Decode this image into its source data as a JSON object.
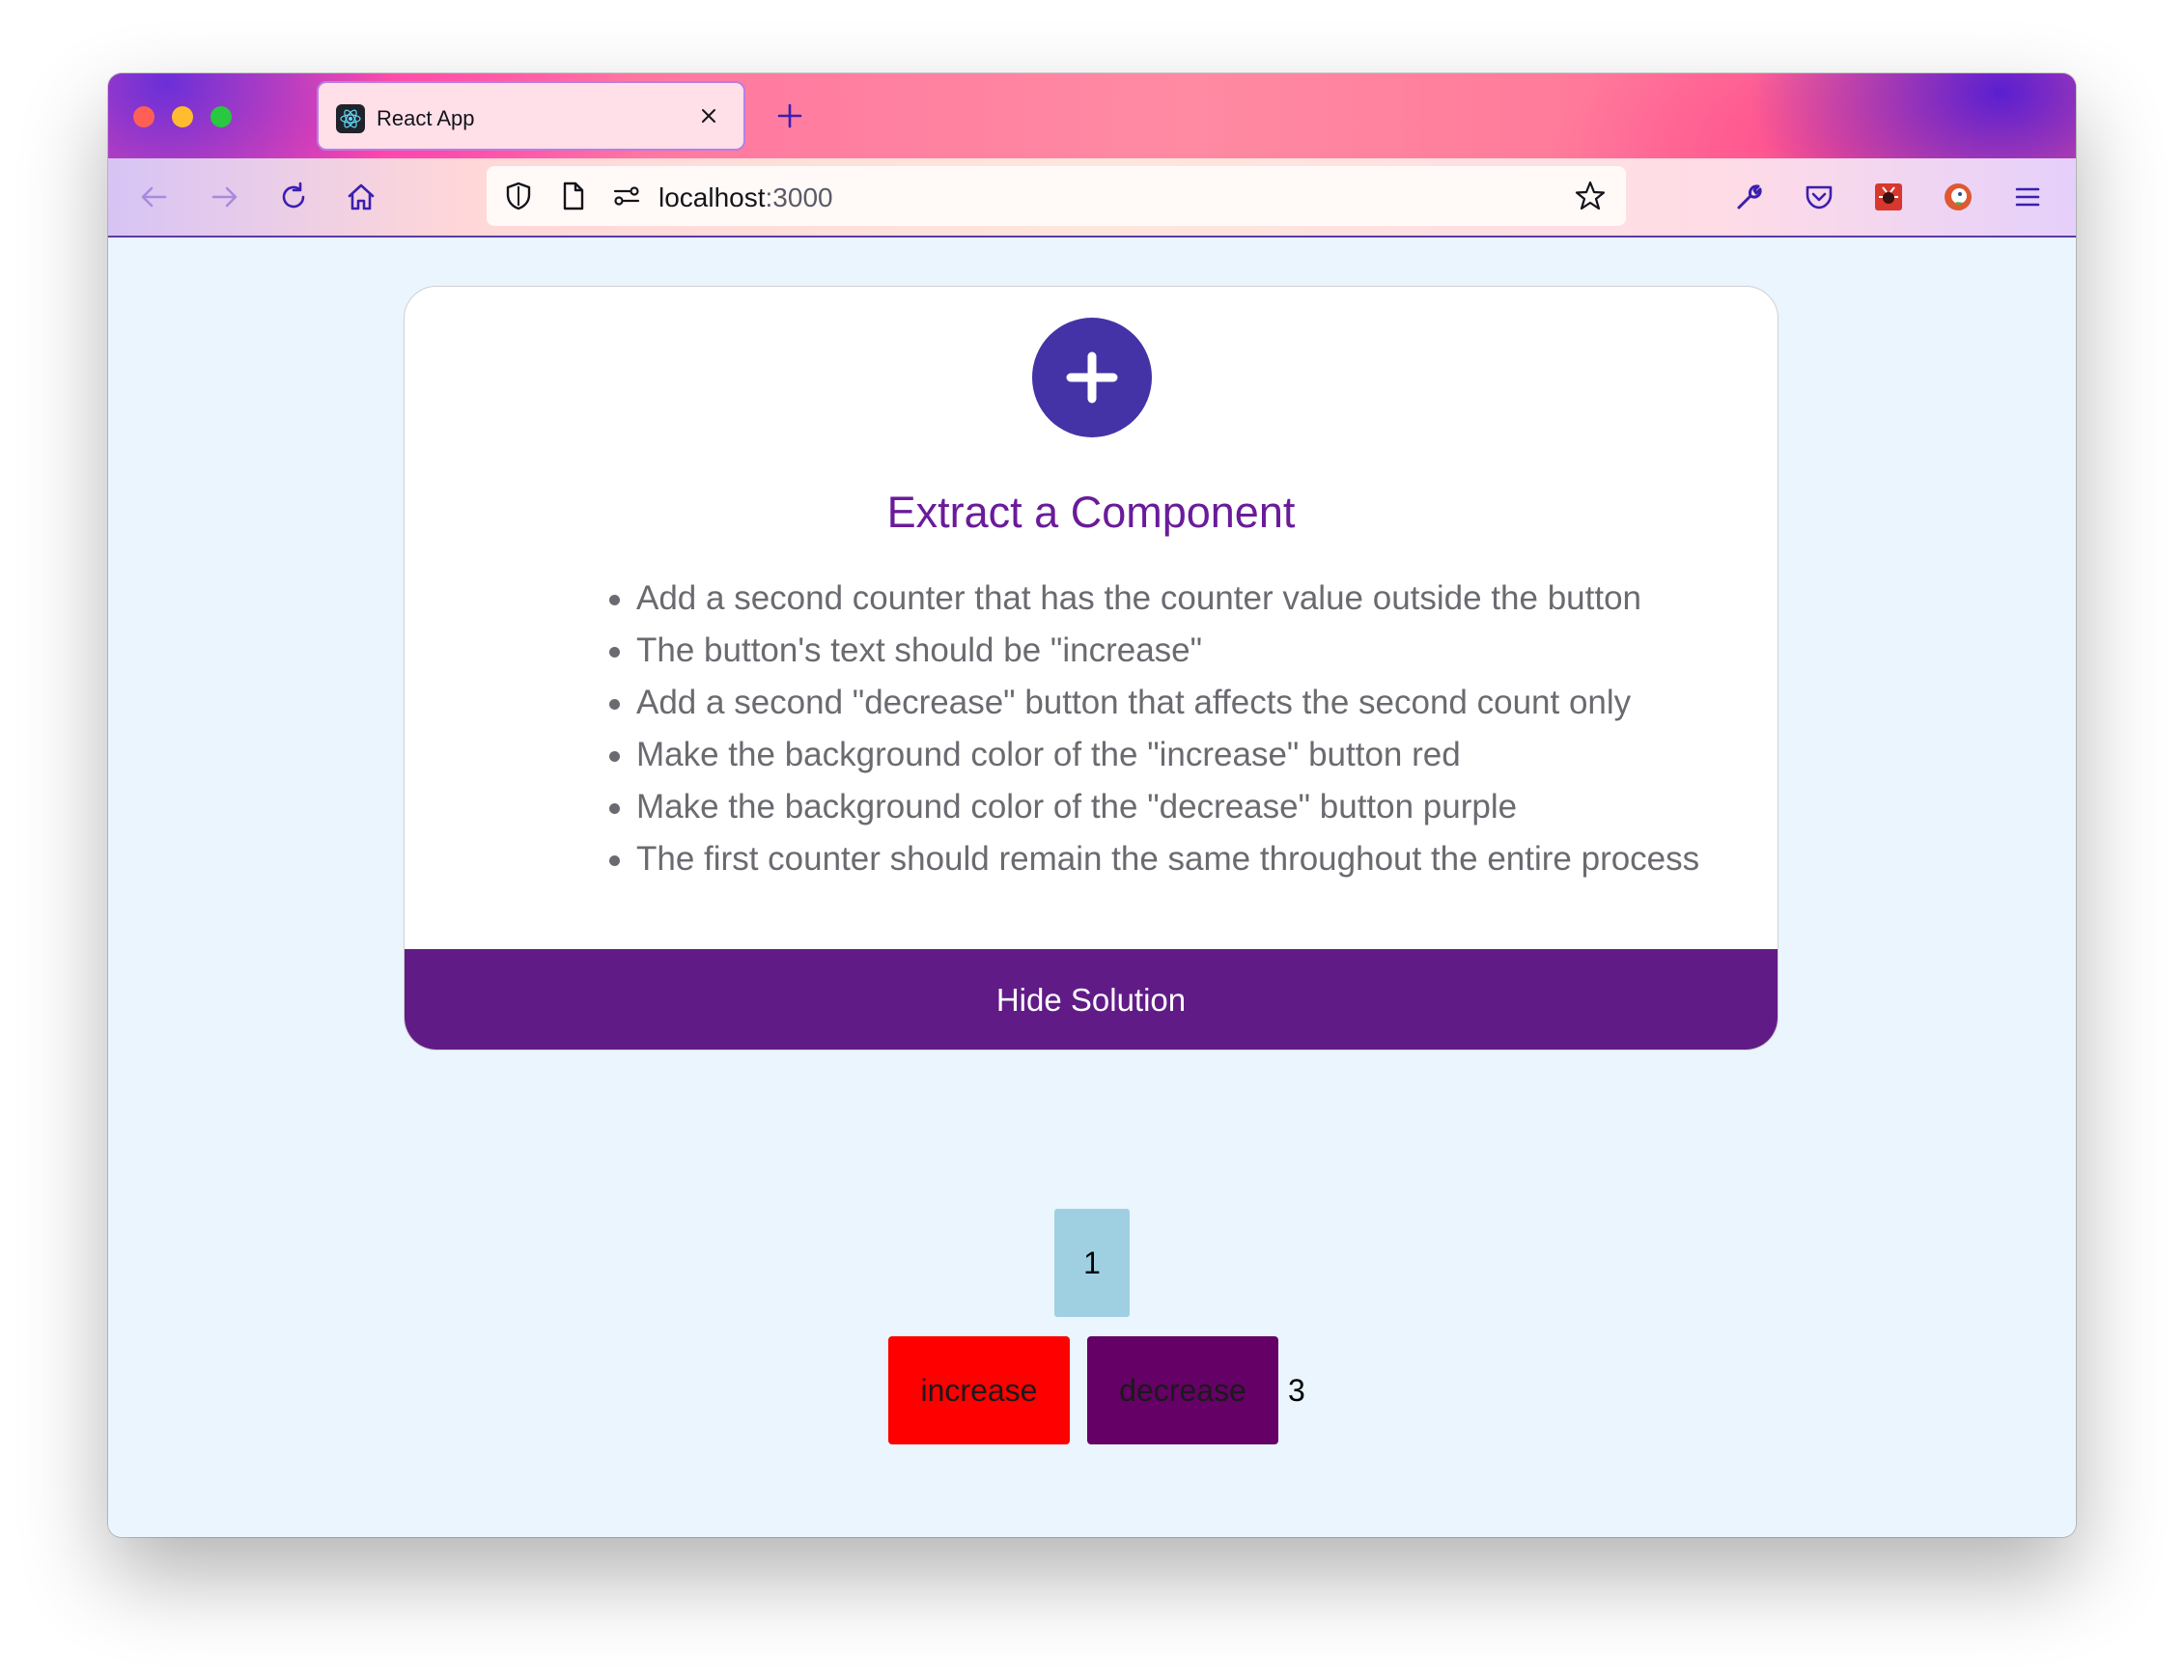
{
  "browser": {
    "tab": {
      "title": "React App",
      "favicon": "react-logo-icon"
    },
    "url": {
      "host": "localhost",
      "port": ":3000"
    },
    "icons": [
      "back-arrow-icon",
      "forward-arrow-icon",
      "reload-icon",
      "home-icon",
      "shield-icon",
      "page-icon",
      "permissions-icon",
      "bookmark-star-icon",
      "wrench-icon",
      "pocket-icon",
      "extension-icon",
      "duckduckgo-icon",
      "menu-icon"
    ]
  },
  "card": {
    "icon": "plus-icon",
    "title": "Extract a Component",
    "tasks": [
      "Add a second counter that has the counter value outside the button",
      "The button's text should be \"increase\"",
      "Add a second \"decrease\" button that affects the second count only",
      "Make the background color of the \"increase\" button red",
      "Make the background color of the \"decrease\" button purple",
      "The first counter should remain the same throughout the entire process"
    ],
    "hide_button": "Hide Solution"
  },
  "counters": {
    "first_value": "1",
    "increase_label": "increase",
    "decrease_label": "decrease",
    "second_value": "3"
  },
  "colors": {
    "accent_purple": "#611b87",
    "title_purple": "#6a1b9a",
    "plus_circle": "#4433a7",
    "increase_bg": "#ff0000",
    "decrease_bg": "#650066",
    "first_counter_bg": "#9fd0e2",
    "page_bg": "#eaf5fe"
  }
}
